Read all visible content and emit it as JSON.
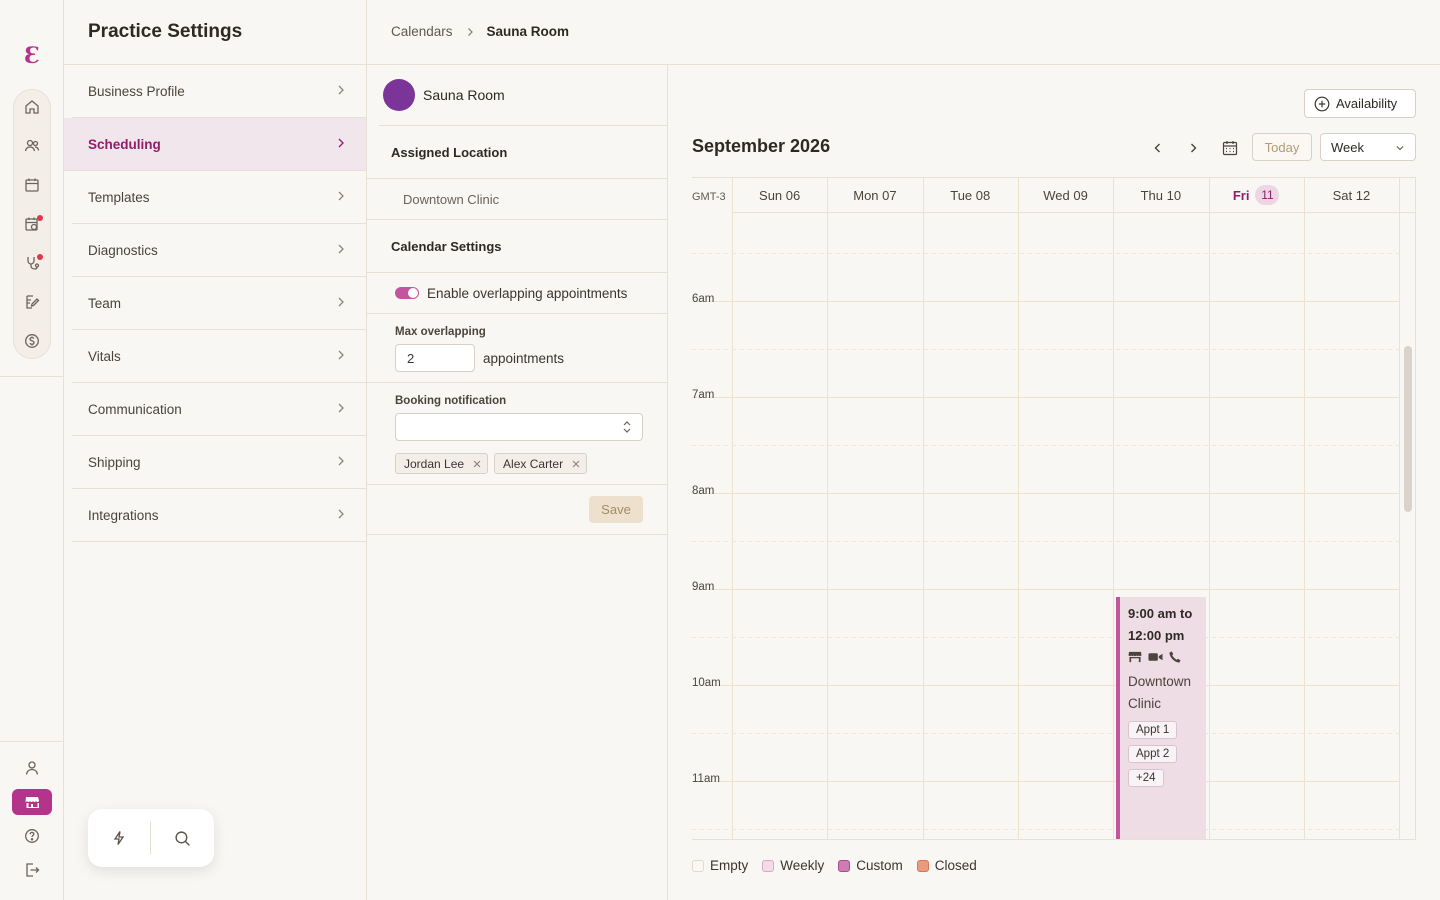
{
  "app": {
    "logo_glyph": "Ɛ"
  },
  "settings": {
    "title": "Practice Settings",
    "menu": [
      {
        "label": "Business Profile",
        "active": false
      },
      {
        "label": "Scheduling",
        "active": true
      },
      {
        "label": "Templates",
        "active": false
      },
      {
        "label": "Diagnostics",
        "active": false
      },
      {
        "label": "Team",
        "active": false
      },
      {
        "label": "Vitals",
        "active": false
      },
      {
        "label": "Communication",
        "active": false
      },
      {
        "label": "Shipping",
        "active": false
      },
      {
        "label": "Integrations",
        "active": false
      }
    ]
  },
  "breadcrumb": {
    "parent": "Calendars",
    "current": "Sauna Room"
  },
  "calendar_panel": {
    "name": "Sauna Room",
    "color": "#7b3498",
    "assigned_location_title": "Assigned Location",
    "location": "Downtown Clinic",
    "settings_title": "Calendar Settings",
    "overlap_toggle_label": "Enable overlapping appointments",
    "overlap_enabled": true,
    "max_overlapping_label": "Max overlapping",
    "max_overlapping_value": "2",
    "max_overlapping_suffix": "appointments",
    "booking_notification_label": "Booking notification",
    "booking_notification_value": "",
    "recipients": [
      "Jordan Lee",
      "Alex Carter"
    ],
    "save_label": "Save"
  },
  "calendar": {
    "availability_label": "Availability",
    "month_title": "September 2026",
    "today_label": "Today",
    "view_label": "Week",
    "timezone": "GMT-3",
    "days": [
      {
        "name": "Sun",
        "date": "06",
        "today": false
      },
      {
        "name": "Mon",
        "date": "07",
        "today": false
      },
      {
        "name": "Tue",
        "date": "08",
        "today": false
      },
      {
        "name": "Wed",
        "date": "09",
        "today": false
      },
      {
        "name": "Thu",
        "date": "10",
        "today": false
      },
      {
        "name": "Fri",
        "date": "11",
        "today": true
      },
      {
        "name": "Sat",
        "date": "12",
        "today": false
      }
    ],
    "hours": [
      "6am",
      "7am",
      "8am",
      "9am",
      "10am",
      "11am"
    ],
    "event": {
      "day": "Thu 10",
      "time": "9:00 am to 12:00 pm",
      "icons": [
        "store-icon",
        "video-icon",
        "phone-icon"
      ],
      "location": "Downtown Clinic",
      "appointments": [
        "Appt 1",
        "Appt 2",
        "+24"
      ],
      "color": "#c2559d"
    },
    "legend": [
      {
        "label": "Empty",
        "fill": "#fbf8f3",
        "border": "#e2d9c9"
      },
      {
        "label": "Weekly",
        "fill": "#f3dbe8",
        "border": "#d9a9c3"
      },
      {
        "label": "Custom",
        "fill": "#d07cb4",
        "border": "#a84c8b"
      },
      {
        "label": "Closed",
        "fill": "#ec9a7c",
        "border": "#d3775a"
      }
    ]
  }
}
